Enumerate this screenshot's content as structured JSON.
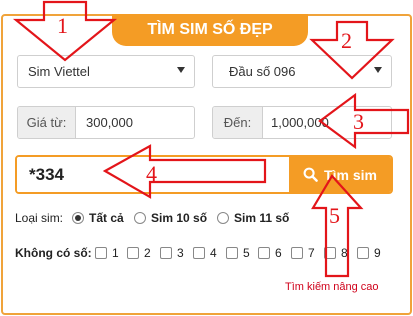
{
  "header": {
    "title": "TÌM SIM SỐ ĐẸP"
  },
  "filters": {
    "network_select": "Sim Viettel",
    "prefix_select": "Đầu số 096"
  },
  "price": {
    "from_label": "Giá từ:",
    "from_value": "300,000",
    "to_label": "Đến:",
    "to_value": "1,000,000"
  },
  "search": {
    "input_value": "*334",
    "button_label": "Tìm sim",
    "button_icon": "search-icon"
  },
  "sim_type": {
    "label": "Loại sim:",
    "options": [
      "Tất cả",
      "Sim 10 số",
      "Sim 11 số"
    ],
    "selected": "Tất cả"
  },
  "exclude_digits": {
    "label": "Không có số:",
    "digits": [
      "1",
      "2",
      "3",
      "4",
      "5",
      "6",
      "7",
      "8",
      "9"
    ]
  },
  "advanced_link": "Tìm kiếm nâng cao",
  "annotations": {
    "color": "#e3151a",
    "markers": [
      "1",
      "2",
      "3",
      "4",
      "5"
    ]
  }
}
